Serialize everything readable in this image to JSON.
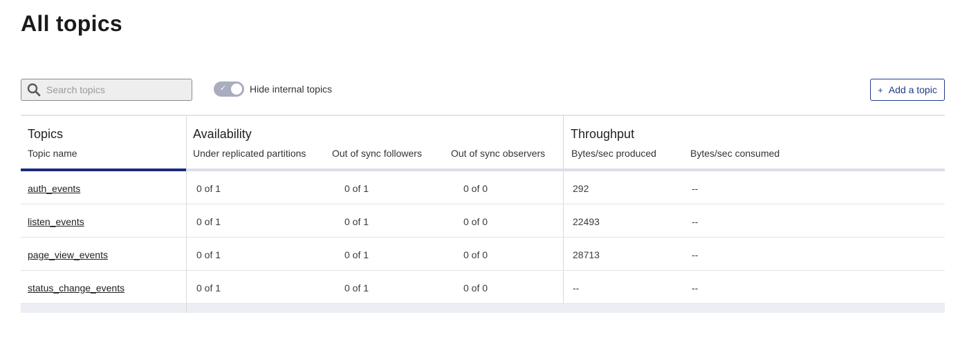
{
  "page": {
    "title": "All topics"
  },
  "toolbar": {
    "search_placeholder": "Search topics",
    "search_value": "",
    "toggle_label": "Hide internal topics",
    "toggle_checked": true,
    "add_button_label": "Add a topic"
  },
  "table": {
    "groups": {
      "topics": "Topics",
      "availability": "Availability",
      "throughput": "Throughput"
    },
    "columns": {
      "topic_name": "Topic name",
      "under_replicated": "Under replicated partitions",
      "out_of_sync_followers": "Out of sync followers",
      "out_of_sync_observers": "Out of sync observers",
      "bytes_produced": "Bytes/sec produced",
      "bytes_consumed": "Bytes/sec consumed"
    },
    "rows": [
      {
        "name": "auth_events",
        "under_replicated": "0 of 1",
        "followers": "0 of 1",
        "observers": "0 of 0",
        "produced": "292",
        "consumed": "--"
      },
      {
        "name": "listen_events",
        "under_replicated": "0 of 1",
        "followers": "0 of 1",
        "observers": "0 of 0",
        "produced": "22493",
        "consumed": "--"
      },
      {
        "name": "page_view_events",
        "under_replicated": "0 of 1",
        "followers": "0 of 1",
        "observers": "0 of 0",
        "produced": "28713",
        "consumed": "--"
      },
      {
        "name": "status_change_events",
        "under_replicated": "0 of 1",
        "followers": "0 of 1",
        "observers": "0 of 0",
        "produced": "--",
        "consumed": "--"
      }
    ]
  },
  "colors": {
    "accent": "#1b2a7a",
    "button": "#1f3a8a",
    "toggle": "#a9adbd"
  }
}
